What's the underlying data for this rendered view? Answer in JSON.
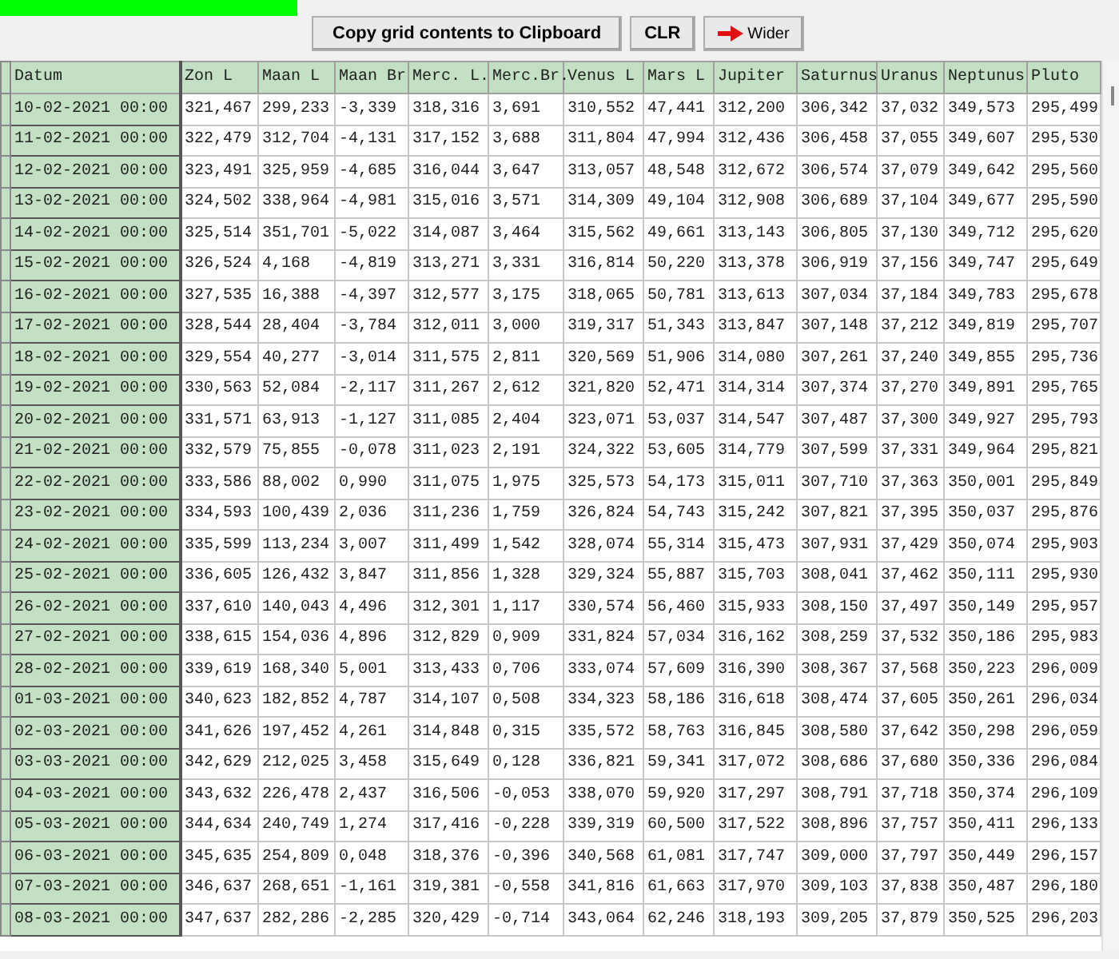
{
  "progress": {
    "level": 0.265
  },
  "buttons": [
    {
      "label": "Copy grid contents to Clipboard",
      "kind": "plain"
    },
    {
      "label": "CLR",
      "kind": "plain"
    },
    {
      "label": "Wider",
      "kind": "arrow"
    }
  ],
  "grid": {
    "columns": [
      "Datum",
      "Zon L",
      "Maan L",
      "Maan Br",
      "Merc. L.",
      "Merc.Br.",
      "Venus L",
      "Mars L",
      "Jupiter",
      "Saturnus",
      "Uranus",
      "Neptunus",
      "Pluto"
    ],
    "rows": [
      {
        "datum": "10-02-2021 00:00",
        "values": [
          "321,467",
          "299,233",
          "-3,339",
          "318,316",
          "3,691",
          "310,552",
          "47,441",
          "312,200",
          "306,342",
          "37,032",
          "349,573",
          "295,499"
        ]
      },
      {
        "datum": "11-02-2021 00:00",
        "values": [
          "322,479",
          "312,704",
          "-4,131",
          "317,152",
          "3,688",
          "311,804",
          "47,994",
          "312,436",
          "306,458",
          "37,055",
          "349,607",
          "295,530"
        ]
      },
      {
        "datum": "12-02-2021 00:00",
        "values": [
          "323,491",
          "325,959",
          "-4,685",
          "316,044",
          "3,647",
          "313,057",
          "48,548",
          "312,672",
          "306,574",
          "37,079",
          "349,642",
          "295,560"
        ]
      },
      {
        "datum": "13-02-2021 00:00",
        "values": [
          "324,502",
          "338,964",
          "-4,981",
          "315,016",
          "3,571",
          "314,309",
          "49,104",
          "312,908",
          "306,689",
          "37,104",
          "349,677",
          "295,590"
        ]
      },
      {
        "datum": "14-02-2021 00:00",
        "values": [
          "325,514",
          "351,701",
          "-5,022",
          "314,087",
          "3,464",
          "315,562",
          "49,661",
          "313,143",
          "306,805",
          "37,130",
          "349,712",
          "295,620"
        ]
      },
      {
        "datum": "15-02-2021 00:00",
        "values": [
          "326,524",
          "4,168",
          "-4,819",
          "313,271",
          "3,331",
          "316,814",
          "50,220",
          "313,378",
          "306,919",
          "37,156",
          "349,747",
          "295,649"
        ]
      },
      {
        "datum": "16-02-2021 00:00",
        "values": [
          "327,535",
          "16,388",
          "-4,397",
          "312,577",
          "3,175",
          "318,065",
          "50,781",
          "313,613",
          "307,034",
          "37,184",
          "349,783",
          "295,678"
        ]
      },
      {
        "datum": "17-02-2021 00:00",
        "values": [
          "328,544",
          "28,404",
          "-3,784",
          "312,011",
          "3,000",
          "319,317",
          "51,343",
          "313,847",
          "307,148",
          "37,212",
          "349,819",
          "295,707"
        ]
      },
      {
        "datum": "18-02-2021 00:00",
        "values": [
          "329,554",
          "40,277",
          "-3,014",
          "311,575",
          "2,811",
          "320,569",
          "51,906",
          "314,080",
          "307,261",
          "37,240",
          "349,855",
          "295,736"
        ]
      },
      {
        "datum": "19-02-2021 00:00",
        "values": [
          "330,563",
          "52,084",
          "-2,117",
          "311,267",
          "2,612",
          "321,820",
          "52,471",
          "314,314",
          "307,374",
          "37,270",
          "349,891",
          "295,765"
        ]
      },
      {
        "datum": "20-02-2021 00:00",
        "values": [
          "331,571",
          "63,913",
          "-1,127",
          "311,085",
          "2,404",
          "323,071",
          "53,037",
          "314,547",
          "307,487",
          "37,300",
          "349,927",
          "295,793"
        ]
      },
      {
        "datum": "21-02-2021 00:00",
        "values": [
          "332,579",
          "75,855",
          "-0,078",
          "311,023",
          "2,191",
          "324,322",
          "53,605",
          "314,779",
          "307,599",
          "37,331",
          "349,964",
          "295,821"
        ]
      },
      {
        "datum": "22-02-2021 00:00",
        "values": [
          "333,586",
          "88,002",
          "0,990",
          "311,075",
          "1,975",
          "325,573",
          "54,173",
          "315,011",
          "307,710",
          "37,363",
          "350,001",
          "295,849"
        ]
      },
      {
        "datum": "23-02-2021 00:00",
        "values": [
          "334,593",
          "100,439",
          "2,036",
          "311,236",
          "1,759",
          "326,824",
          "54,743",
          "315,242",
          "307,821",
          "37,395",
          "350,037",
          "295,876"
        ]
      },
      {
        "datum": "24-02-2021 00:00",
        "values": [
          "335,599",
          "113,234",
          "3,007",
          "311,499",
          "1,542",
          "328,074",
          "55,314",
          "315,473",
          "307,931",
          "37,429",
          "350,074",
          "295,903"
        ]
      },
      {
        "datum": "25-02-2021 00:00",
        "values": [
          "336,605",
          "126,432",
          "3,847",
          "311,856",
          "1,328",
          "329,324",
          "55,887",
          "315,703",
          "308,041",
          "37,462",
          "350,111",
          "295,930"
        ]
      },
      {
        "datum": "26-02-2021 00:00",
        "values": [
          "337,610",
          "140,043",
          "4,496",
          "312,301",
          "1,117",
          "330,574",
          "56,460",
          "315,933",
          "308,150",
          "37,497",
          "350,149",
          "295,957"
        ]
      },
      {
        "datum": "27-02-2021 00:00",
        "values": [
          "338,615",
          "154,036",
          "4,896",
          "312,829",
          "0,909",
          "331,824",
          "57,034",
          "316,162",
          "308,259",
          "37,532",
          "350,186",
          "295,983"
        ]
      },
      {
        "datum": "28-02-2021 00:00",
        "values": [
          "339,619",
          "168,340",
          "5,001",
          "313,433",
          "0,706",
          "333,074",
          "57,609",
          "316,390",
          "308,367",
          "37,568",
          "350,223",
          "296,009"
        ]
      },
      {
        "datum": "01-03-2021 00:00",
        "values": [
          "340,623",
          "182,852",
          "4,787",
          "314,107",
          "0,508",
          "334,323",
          "58,186",
          "316,618",
          "308,474",
          "37,605",
          "350,261",
          "296,034"
        ]
      },
      {
        "datum": "02-03-2021 00:00",
        "values": [
          "341,626",
          "197,452",
          "4,261",
          "314,848",
          "0,315",
          "335,572",
          "58,763",
          "316,845",
          "308,580",
          "37,642",
          "350,298",
          "296,059"
        ]
      },
      {
        "datum": "03-03-2021 00:00",
        "values": [
          "342,629",
          "212,025",
          "3,458",
          "315,649",
          "0,128",
          "336,821",
          "59,341",
          "317,072",
          "308,686",
          "37,680",
          "350,336",
          "296,084"
        ]
      },
      {
        "datum": "04-03-2021 00:00",
        "values": [
          "343,632",
          "226,478",
          "2,437",
          "316,506",
          "-0,053",
          "338,070",
          "59,920",
          "317,297",
          "308,791",
          "37,718",
          "350,374",
          "296,109"
        ]
      },
      {
        "datum": "05-03-2021 00:00",
        "values": [
          "344,634",
          "240,749",
          "1,274",
          "317,416",
          "-0,228",
          "339,319",
          "60,500",
          "317,522",
          "308,896",
          "37,757",
          "350,411",
          "296,133"
        ]
      },
      {
        "datum": "06-03-2021 00:00",
        "values": [
          "345,635",
          "254,809",
          "0,048",
          "318,376",
          "-0,396",
          "340,568",
          "61,081",
          "317,747",
          "309,000",
          "37,797",
          "350,449",
          "296,157"
        ]
      },
      {
        "datum": "07-03-2021 00:00",
        "values": [
          "346,637",
          "268,651",
          "-1,161",
          "319,381",
          "-0,558",
          "341,816",
          "61,663",
          "317,970",
          "309,103",
          "37,838",
          "350,487",
          "296,180"
        ]
      },
      {
        "datum": "08-03-2021 00:00",
        "values": [
          "347,637",
          "282,286",
          "-2,285",
          "320,429",
          "-0,714",
          "343,064",
          "62,246",
          "318,193",
          "309,205",
          "37,879",
          "350,525",
          "296,203"
        ]
      }
    ]
  }
}
